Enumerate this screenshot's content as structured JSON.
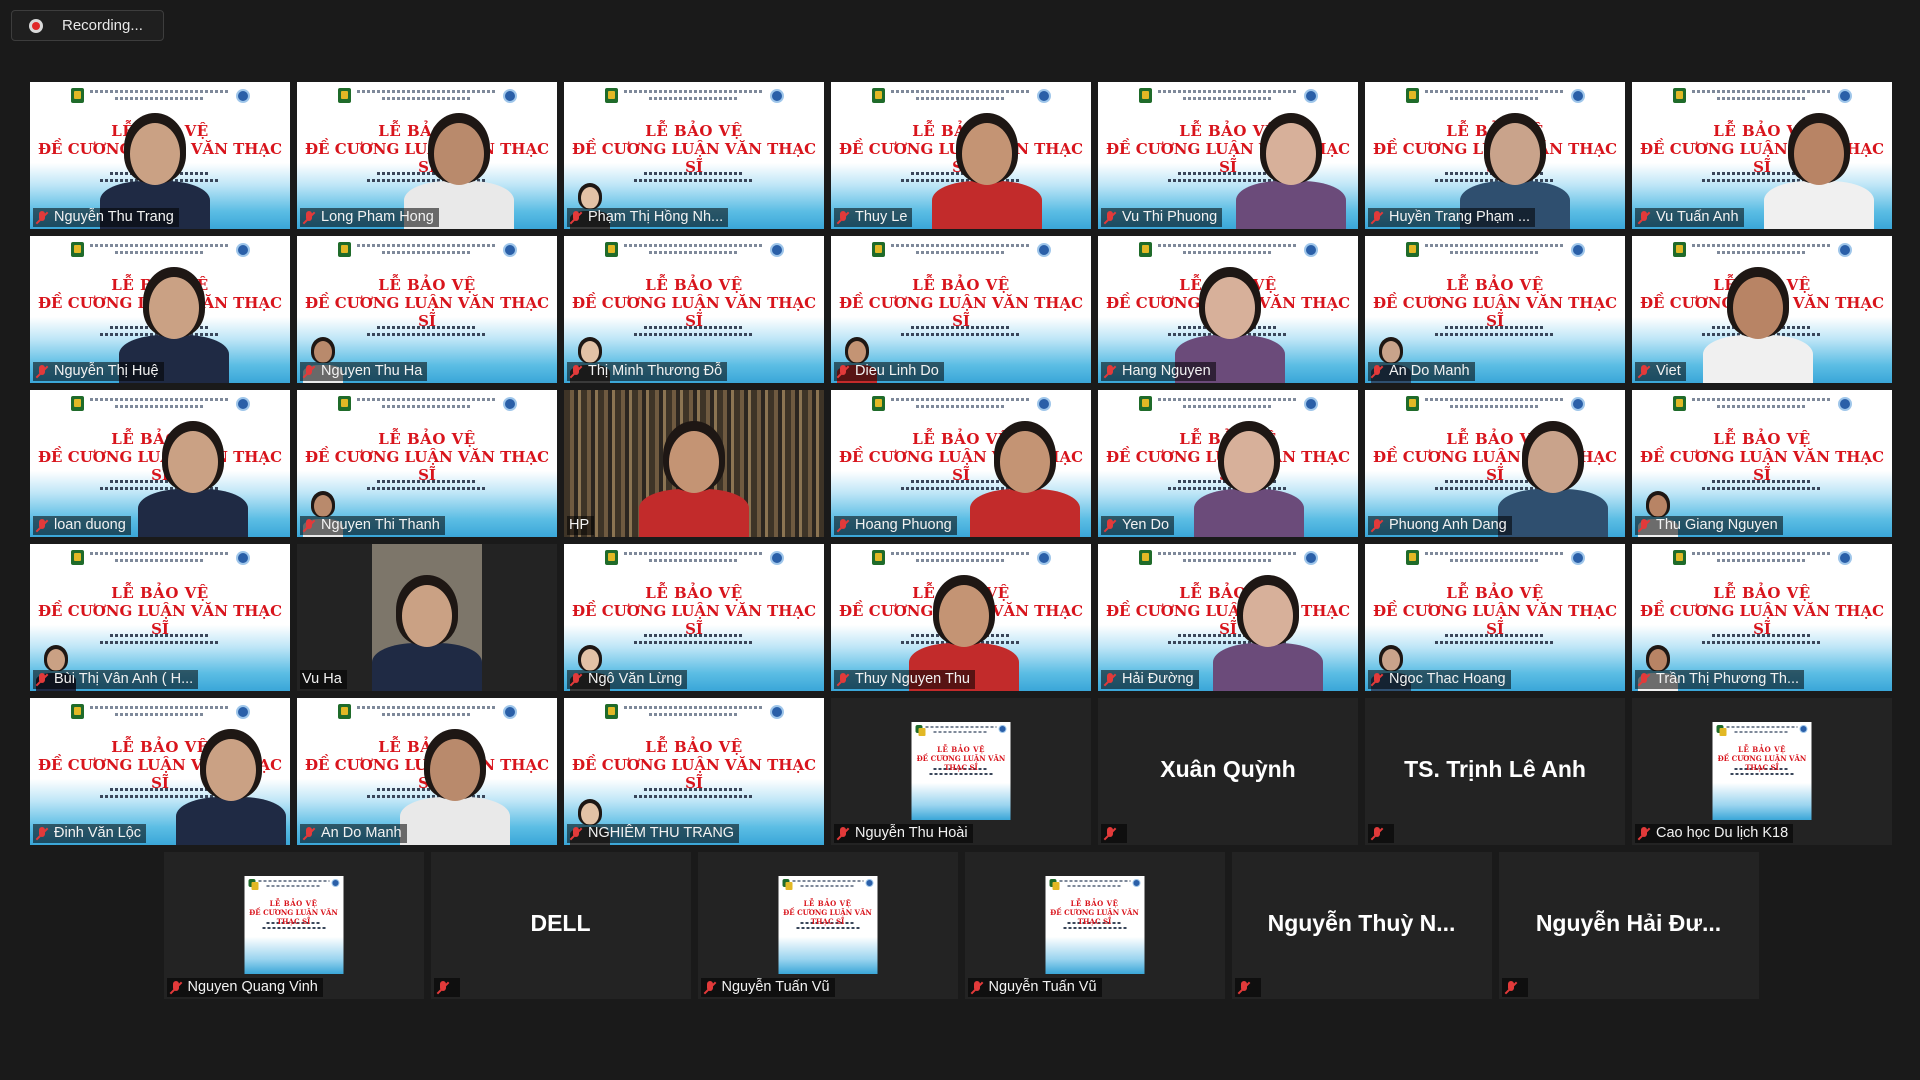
{
  "recording": {
    "label": "Recording..."
  },
  "colors": {
    "background": "#1a1a1a",
    "tile": "#232323",
    "active_speaker_border": "#c9d238",
    "muted_icon": "#e23a3a",
    "slide_title": "#d8141c"
  },
  "slide": {
    "line1": "LỄ BẢO VỆ",
    "line2": "ĐỀ CƯƠNG LUẬN VĂN THẠC SĨ"
  },
  "participants": [
    {
      "name": "Nguyễn Thu Trang",
      "muted": true
    },
    {
      "name": "Long Pham Hong",
      "muted": true
    },
    {
      "name": "Phạm Thị Hồng Nh...",
      "muted": true
    },
    {
      "name": "Thuy Le",
      "muted": true
    },
    {
      "name": "Vu Thi Phuong",
      "muted": true
    },
    {
      "name": "Huyền Trang Phạm ...",
      "muted": true
    },
    {
      "name": "Vu Tuấn Anh",
      "muted": true
    },
    {
      "name": "Nguyễn Thị Huệ",
      "muted": true
    },
    {
      "name": "Nguyen Thu Ha",
      "muted": true
    },
    {
      "name": "Thị Minh Thương Đỗ",
      "muted": true
    },
    {
      "name": "Dieu Linh Do",
      "muted": true
    },
    {
      "name": "Hang Nguyen",
      "muted": true
    },
    {
      "name": "An Do Manh",
      "muted": true
    },
    {
      "name": "Viet",
      "muted": true
    },
    {
      "name": "loan duong",
      "muted": true
    },
    {
      "name": "Nguyen Thi Thanh",
      "muted": true
    },
    {
      "name": "HP",
      "muted": false
    },
    {
      "name": "Hoang Phuong",
      "muted": true
    },
    {
      "name": "Yen Do",
      "muted": true
    },
    {
      "name": "Phuong Anh Dang",
      "muted": true
    },
    {
      "name": "Thu Giang Nguyen",
      "muted": true
    },
    {
      "name": "Bùi Thị Vân Anh ( H...",
      "muted": true
    },
    {
      "name": "Vu Ha",
      "muted": false
    },
    {
      "name": "Ngô Văn Lừng",
      "muted": true
    },
    {
      "name": "Thuy Nguyen Thu",
      "muted": true
    },
    {
      "name": "Hải Đường",
      "muted": true
    },
    {
      "name": "Ngoc Thac Hoang",
      "muted": true
    },
    {
      "name": "Trần Thị Phương Th...",
      "muted": true
    },
    {
      "name": "Đinh Văn Lộc",
      "muted": true
    },
    {
      "name": "An Do Manh",
      "muted": true
    },
    {
      "name": "NGHIÊM THU TRANG",
      "muted": true
    },
    {
      "name": "Nguyễn Thu Hoài",
      "muted": true
    },
    {
      "name": "",
      "big_name": "Xuân Quỳnh",
      "muted": true
    },
    {
      "name": "",
      "big_name": "TS. Trịnh Lê Anh",
      "muted": true
    },
    {
      "name": "Cao học Du lịch K18",
      "muted": true
    },
    {
      "name": "Nguyen Quang Vinh",
      "muted": true
    },
    {
      "name": "",
      "big_name": "DELL",
      "muted": true
    },
    {
      "name": "Nguyễn Tuấn Vũ",
      "muted": true
    },
    {
      "name": "Nguyễn Tuấn Vũ",
      "muted": true
    },
    {
      "name": "",
      "big_name": "Nguyễn Thuỳ N...",
      "muted": true
    },
    {
      "name": "",
      "big_name": "Nguyễn Hải Đư...",
      "muted": true
    }
  ]
}
